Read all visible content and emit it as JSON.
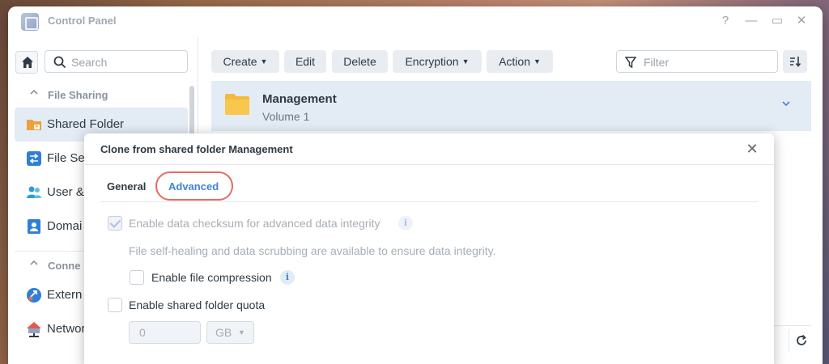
{
  "window": {
    "title": "Control Panel",
    "controls": {
      "help": "?",
      "minimize": "—",
      "maximize": "▭",
      "close": "✕"
    }
  },
  "sidebar": {
    "search_placeholder": "Search",
    "sections": [
      {
        "label": "File Sharing",
        "chevron": "^"
      },
      {
        "label": "Conne",
        "chevron": "^"
      }
    ],
    "items": [
      {
        "label": "Shared Folder",
        "icon": "shared-folder-icon",
        "active": true
      },
      {
        "label": "File Se",
        "icon": "file-services-icon"
      },
      {
        "label": "User &",
        "icon": "user-group-icon"
      },
      {
        "label": "Domai",
        "icon": "domain-icon"
      },
      {
        "label": "Extern",
        "icon": "external-access-icon"
      },
      {
        "label": "Networ",
        "icon": "network-icon"
      }
    ]
  },
  "toolbar": {
    "create_label": "Create",
    "edit_label": "Edit",
    "delete_label": "Delete",
    "encryption_label": "Encryption",
    "action_label": "Action",
    "filter_placeholder": "Filter"
  },
  "folder_list": [
    {
      "name": "Management",
      "volume": "Volume 1",
      "expanded": false
    }
  ],
  "dialog": {
    "title": "Clone from shared folder Management",
    "close": "✕",
    "tabs": [
      {
        "label": "General",
        "active": false
      },
      {
        "label": "Advanced",
        "active": true
      }
    ],
    "options": {
      "checksum_label": "Enable data checksum for advanced data integrity",
      "checksum_checked": true,
      "checksum_disabled": true,
      "checksum_desc": "File self-healing and data scrubbing are available to ensure data integrity.",
      "compression_label": "Enable file compression",
      "compression_checked": false,
      "quota_label": "Enable shared folder quota",
      "quota_checked": false,
      "quota_value": "0",
      "quota_unit": "GB"
    },
    "info_glyph": "i"
  },
  "colors": {
    "accent": "#3d84d6",
    "highlight_ring": "#e86a60",
    "selection_bg": "#e3ebf5"
  }
}
